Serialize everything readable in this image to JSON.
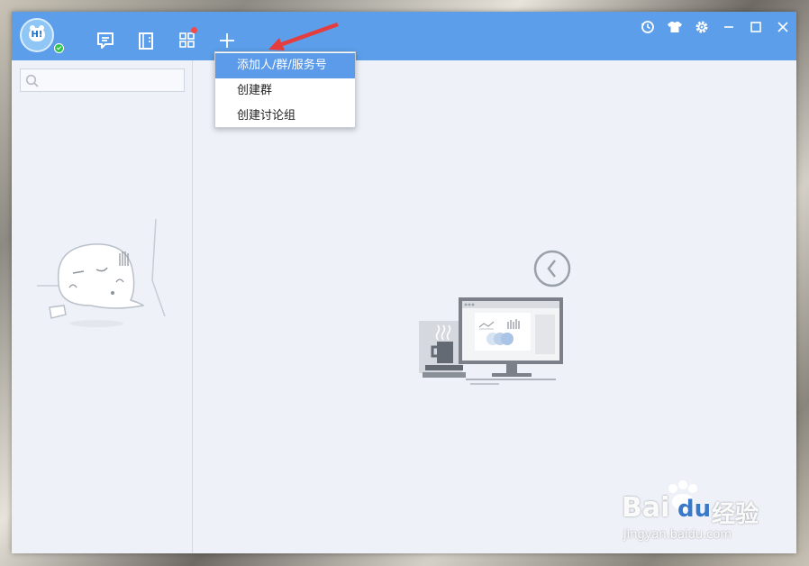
{
  "toolbar": {
    "avatar_text": "H!",
    "icons": [
      "chat-icon",
      "contacts-icon",
      "apps-icon",
      "plus-icon"
    ],
    "apps_has_notification": true
  },
  "window_controls": [
    "history-icon",
    "skin-icon",
    "settings-icon",
    "minimize-icon",
    "maximize-icon",
    "close-icon"
  ],
  "search": {
    "placeholder": "",
    "value": ""
  },
  "menu": {
    "items": [
      {
        "label": "添加人/群/服务号",
        "active": true
      },
      {
        "label": "创建群",
        "active": false
      },
      {
        "label": "创建讨论组",
        "active": false
      }
    ]
  },
  "watermark": {
    "brand": "Bai",
    "brand2": "du",
    "cn": "经验",
    "url": "jingyan.baidu.com"
  },
  "colors": {
    "titlebar": "#5c9ee9",
    "accent": "#5b9bea",
    "background": "#eef2f8",
    "notify": "#f24a4a",
    "online": "#32c24d"
  }
}
